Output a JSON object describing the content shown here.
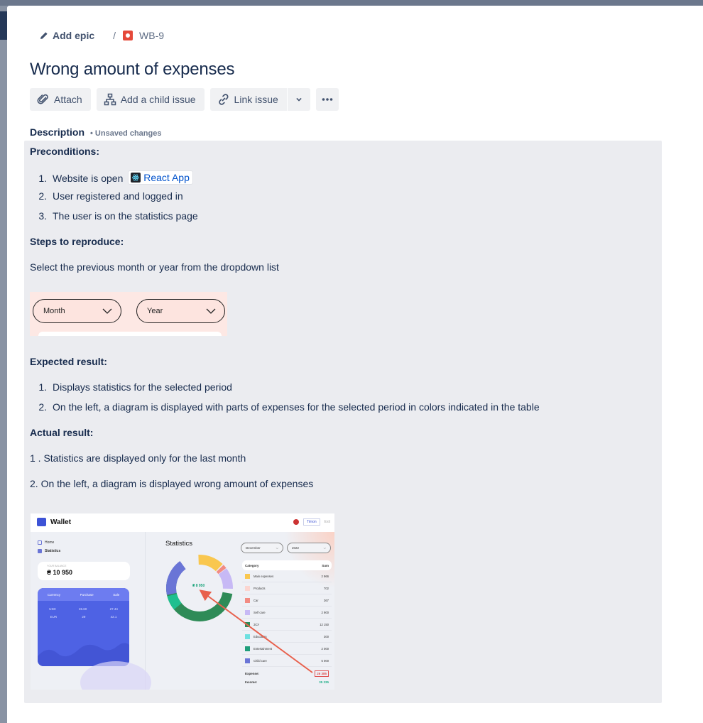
{
  "breadcrumb": {
    "add_epic": "Add epic",
    "separator": "/",
    "issue_key": "WB-9"
  },
  "issue": {
    "title": "Wrong amount of expenses"
  },
  "toolbar": {
    "attach": "Attach",
    "add_child": "Add a child issue",
    "link_issue": "Link issue"
  },
  "description": {
    "label": "Description",
    "status": "• Unsaved changes",
    "preconditions_heading": "Preconditions:",
    "preconditions": [
      {
        "num": "1.",
        "text": "Website is open",
        "link": "React App"
      },
      {
        "num": "2.",
        "text": "User registered and logged in"
      },
      {
        "num": "3.",
        "text": "The user is on the statistics page"
      }
    ],
    "steps_heading": "Steps to reproduce:",
    "steps_text": "Select the previous month or year from the dropdown list",
    "dropdown_image": {
      "month": "Month",
      "year": "Year"
    },
    "expected_heading": "Expected result:",
    "expected": [
      {
        "num": "1.",
        "text": "Displays statistics for the selected period"
      },
      {
        "num": "2.",
        "text": "On the left, a diagram is displayed with parts of expenses for the selected period in colors indicated in the table"
      }
    ],
    "actual_heading": "Actual result:",
    "actual_1": "1 . Statistics are displayed only for the last month",
    "actual_2": "2. On the left, a diagram is displayed wrong amount of expenses"
  },
  "screenshot": {
    "app_name": "Wallet",
    "user": "Timon",
    "exit": "Exit",
    "nav": [
      "Home",
      "Statistics"
    ],
    "balance_label": "YOUR BALANCE",
    "balance": "₴ 10 950",
    "currency_headers": [
      "Currency",
      "Purchase",
      "Sale"
    ],
    "currency_rows": [
      [
        "USD",
        "26.60",
        "27.44"
      ],
      [
        "EUR",
        "29",
        "42.1"
      ]
    ],
    "stat_title": "Statistics",
    "donut_value": "₴ 8 950",
    "month_select": "December",
    "year_select": "2022",
    "table_headers": [
      "Category",
      "Sum"
    ],
    "table_rows": [
      {
        "name": "Main expenses",
        "sum": "2 966",
        "color": "#f9c74f"
      },
      {
        "name": "Products",
        "sum": "702",
        "color": "#fbd5d0"
      },
      {
        "name": "Car",
        "sum": "367",
        "color": "#f28b82"
      },
      {
        "name": "Self care",
        "sum": "2 900",
        "color": "#c7b9f5"
      },
      {
        "name": "ЗСУ",
        "sum": "12 150",
        "color": "#2e8b57"
      },
      {
        "name": "Education",
        "sum": "300",
        "color": "#6ee0e0"
      },
      {
        "name": "Entertainment",
        "sum": "2 000",
        "color": "#1f9e7a"
      },
      {
        "name": "Child care",
        "sum": "5 000",
        "color": "#6a75d6"
      }
    ],
    "expense_label": "Expense:",
    "expense_value": "26 385",
    "income_label": "Income:",
    "income_value": "35 335"
  },
  "colors": {
    "issue_type": "#e5493a",
    "link": "#0052cc",
    "editor_bg": "#ebecf0"
  }
}
